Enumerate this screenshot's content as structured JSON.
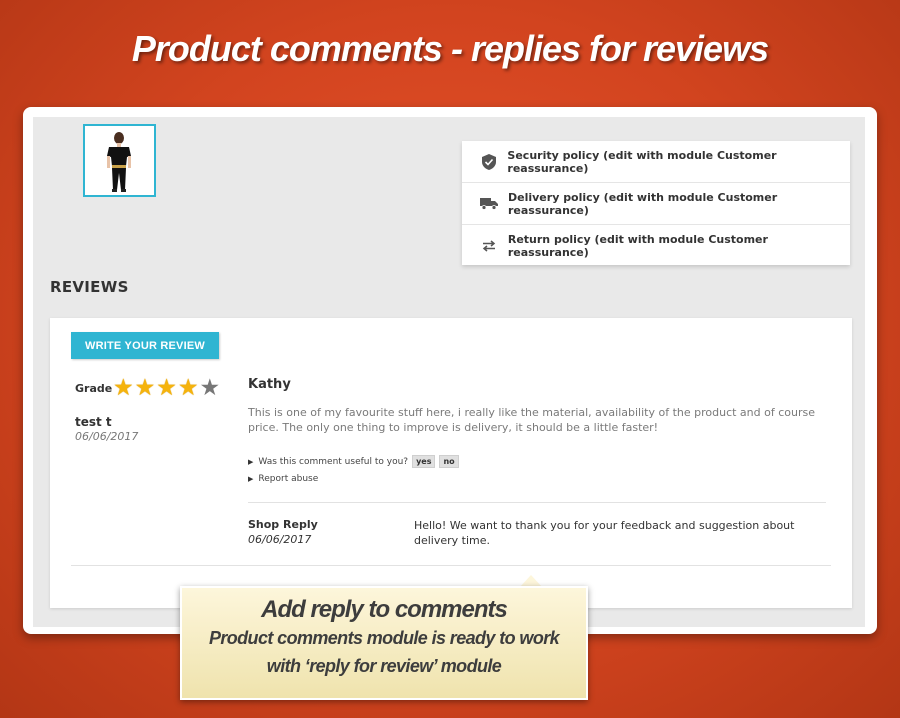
{
  "banner": {
    "title": "Product comments - replies for reviews"
  },
  "policies": [
    {
      "icon": "shield-icon",
      "label": "Security policy (edit with module Customer reassurance)"
    },
    {
      "icon": "truck-icon",
      "label": "Delivery policy (edit with module Customer reassurance)"
    },
    {
      "icon": "exchange-icon",
      "label": "Return policy (edit with module Customer reassurance)"
    }
  ],
  "reviews": {
    "heading": "REVIEWS",
    "write_button": "WRITE YOUR REVIEW",
    "grade_label": "Grade",
    "rating": {
      "value": 4,
      "max": 5
    },
    "author": "test t",
    "date": "06/06/2017",
    "title": "Kathy",
    "text": "This is one of my favourite stuff here, i really like the material, availability of the product and of course price. The only one thing to improve is delivery, it should be a little faster!",
    "useful_question": "Was this comment useful to you?",
    "yes": "yes",
    "no": "no",
    "report": "Report abuse",
    "reply": {
      "label": "Shop Reply",
      "date": "06/06/2017",
      "text": "Hello! We want to thank you for your feedback and suggestion about delivery time."
    }
  },
  "callout": {
    "heading": "Add reply to comments",
    "line1": "Product comments module is ready to work",
    "line2": "with ‘reply for review’ module"
  },
  "colors": {
    "accent": "#2fb5d2",
    "star": "#f5b30d",
    "background": "#d2441f"
  }
}
